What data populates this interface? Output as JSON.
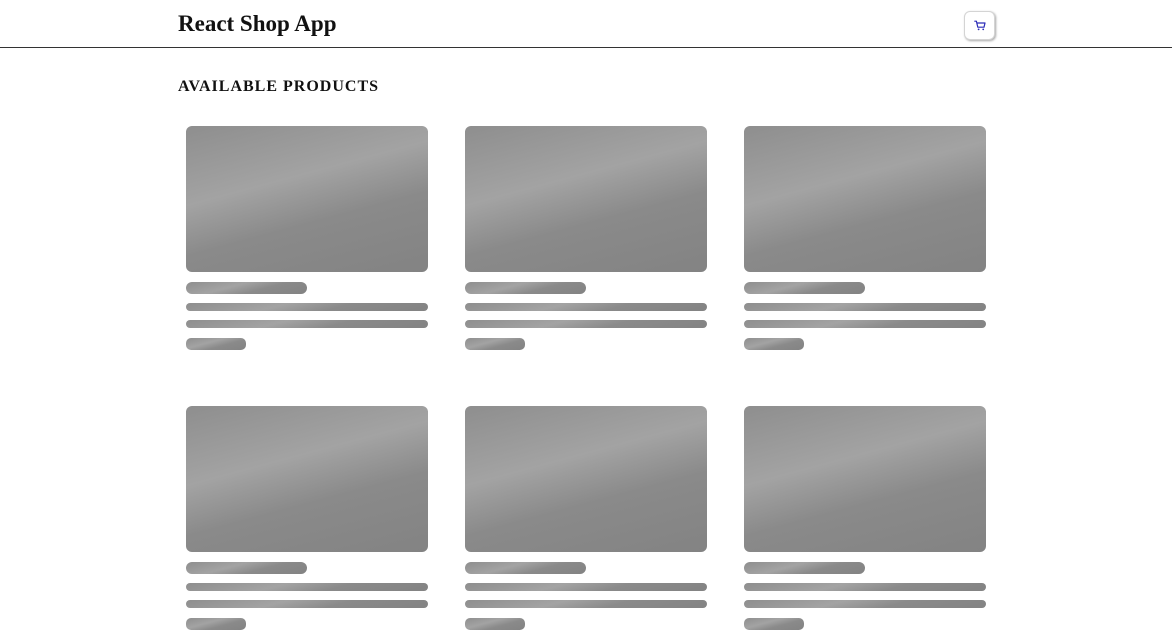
{
  "header": {
    "title": "React Shop App",
    "cart_icon": "shopping-cart-icon",
    "cart_icon_color": "#2b2bb8"
  },
  "main": {
    "section_title": "AVAILABLE PRODUCTS",
    "skeleton_color": "#9a9a9a",
    "products": [
      {
        "state": "loading"
      },
      {
        "state": "loading"
      },
      {
        "state": "loading"
      },
      {
        "state": "loading"
      },
      {
        "state": "loading"
      },
      {
        "state": "loading"
      }
    ]
  }
}
